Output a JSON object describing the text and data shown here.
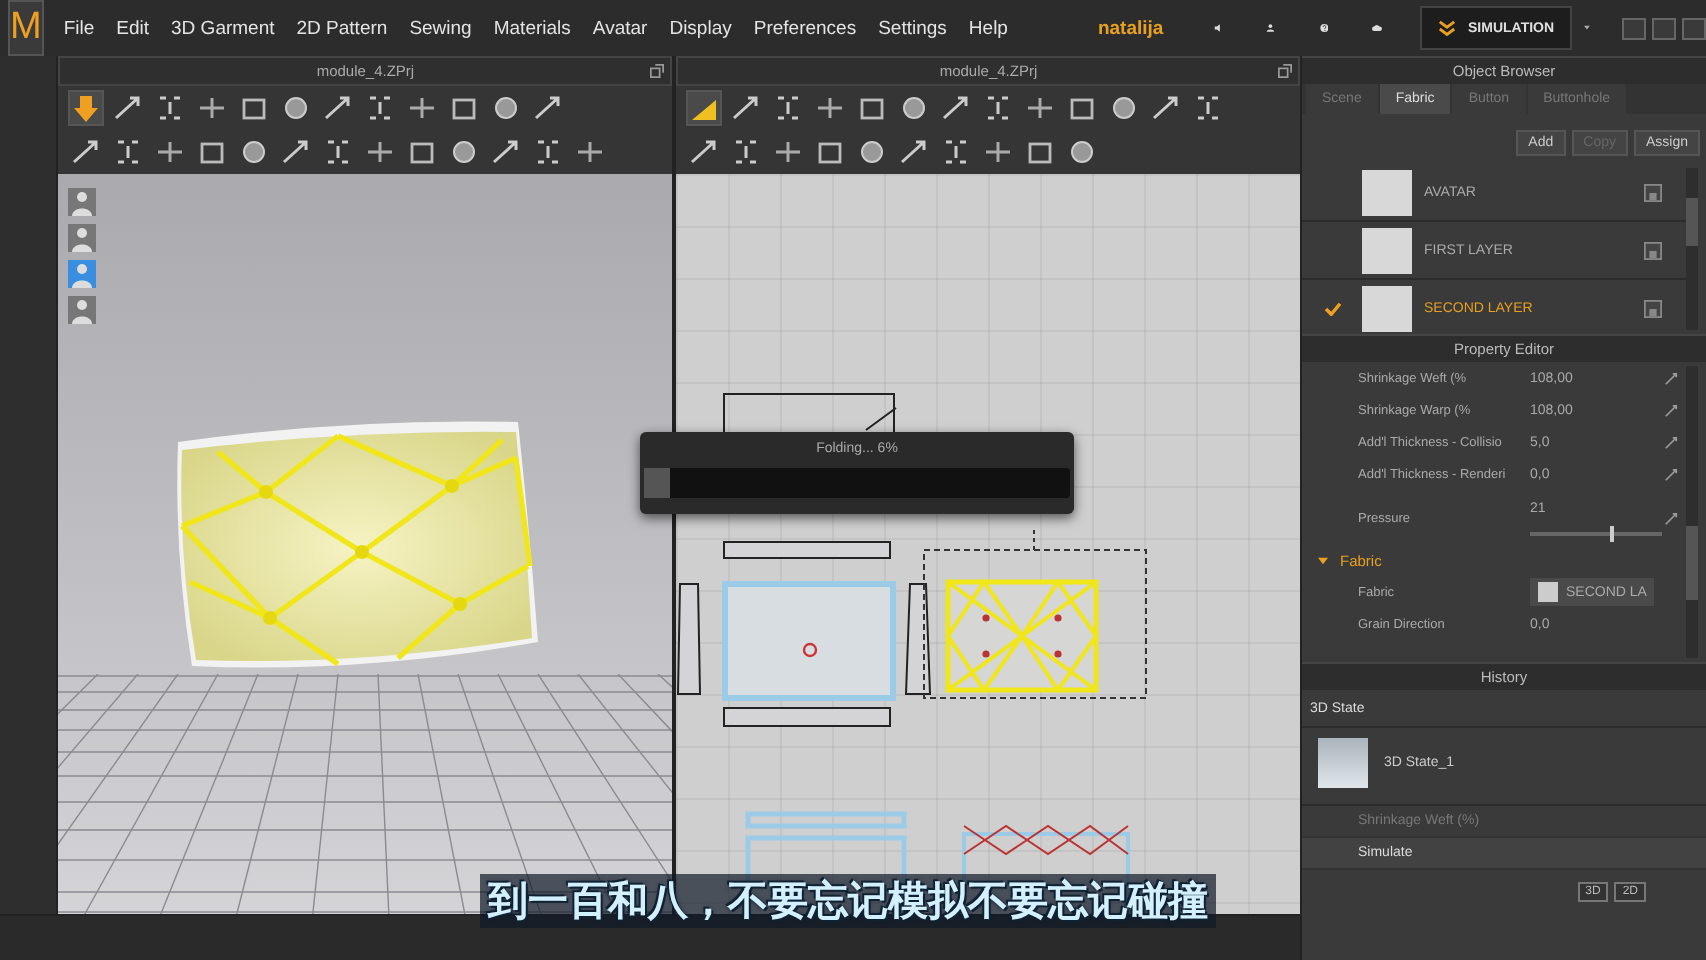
{
  "app": {
    "logo": "M"
  },
  "menu": [
    "File",
    "Edit",
    "3D Garment",
    "2D Pattern",
    "Sewing",
    "Materials",
    "Avatar",
    "Display",
    "Preferences",
    "Settings",
    "Help"
  ],
  "user": {
    "name": "natalija"
  },
  "simulation_button": {
    "label": "SIMULATION"
  },
  "viewports": [
    {
      "title": "module_4.ZPrj"
    },
    {
      "title": "module_4.ZPrj"
    }
  ],
  "progress": {
    "label": "Folding... 6%",
    "level": 0.06
  },
  "subtitle": "到一百和八，不要忘记模拟不要忘记碰撞",
  "object_browser": {
    "title": "Object Browser",
    "tabs": [
      {
        "label": "Scene",
        "selected": false
      },
      {
        "label": "Fabric",
        "selected": true
      },
      {
        "label": "Button",
        "selected": false
      },
      {
        "label": "Buttonhole",
        "selected": false
      }
    ],
    "actions": [
      {
        "label": "Add",
        "disabled": false
      },
      {
        "label": "Copy",
        "disabled": true
      },
      {
        "label": "Assign",
        "disabled": false
      }
    ],
    "fabrics": [
      {
        "name": "AVATAR",
        "selected": false
      },
      {
        "name": "FIRST LAYER",
        "selected": false
      },
      {
        "name": "SECOND LAYER",
        "selected": true
      }
    ]
  },
  "property_editor": {
    "title": "Property Editor",
    "properties": [
      {
        "kind": "value",
        "label": "Shrinkage Weft (%",
        "value": "108,00"
      },
      {
        "kind": "value",
        "label": "Shrinkage Warp (%",
        "value": "108,00"
      },
      {
        "kind": "value",
        "label": "Add'l Thickness - Collisio",
        "value": "5,0"
      },
      {
        "kind": "value",
        "label": "Add'l Thickness - Renderi",
        "value": "0,0"
      },
      {
        "kind": "slider",
        "label": "Pressure",
        "value": "21",
        "level": 0.6
      }
    ],
    "section": {
      "label": "Fabric",
      "expanded": true,
      "properties": [
        {
          "kind": "swatch",
          "label": "Fabric",
          "value": "SECOND LA"
        },
        {
          "kind": "value",
          "label": "Grain Direction",
          "value": "0,0"
        }
      ]
    }
  },
  "history": {
    "title": "History",
    "group": "3D State",
    "states": [
      {
        "name": "3D State_1"
      }
    ],
    "steps": [
      {
        "label": "Shrinkage Weft (%)",
        "faded": true
      },
      {
        "label": "Simulate",
        "faded": false
      }
    ],
    "view_buttons": [
      "3D",
      "2D"
    ]
  }
}
